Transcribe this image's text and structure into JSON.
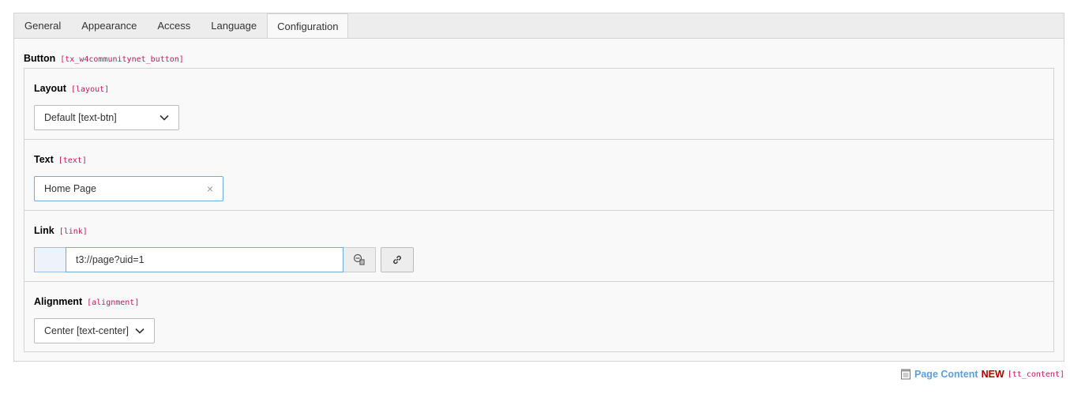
{
  "tabs": [
    {
      "label": "General"
    },
    {
      "label": "Appearance"
    },
    {
      "label": "Access"
    },
    {
      "label": "Language"
    },
    {
      "label": "Configuration",
      "active": true
    }
  ],
  "group": {
    "label": "Button",
    "code": "[tx_w4communitynet_button]"
  },
  "fields": {
    "layout": {
      "label": "Layout",
      "code": "[layout]",
      "value": "Default [text-btn]"
    },
    "text": {
      "label": "Text",
      "code": "[text]",
      "value": "Home Page"
    },
    "link": {
      "label": "Link",
      "code": "[link]",
      "value": "t3://page?uid=1"
    },
    "alignment": {
      "label": "Alignment",
      "code": "[alignment]",
      "value": "Center [text-center]"
    }
  },
  "footer": {
    "title": "Page Content",
    "badge": "NEW",
    "table": "[tt_content]"
  },
  "icons": {
    "clear": "×",
    "chevron": "chevron-down-icon",
    "wizard": "wizard-icon",
    "link": "link-icon",
    "doc": "document-icon"
  },
  "colors": {
    "accent_link": "#5e9ed6",
    "new_badge": "#aa0000",
    "code": "#c2185b",
    "focus_border": "#6daae0"
  }
}
